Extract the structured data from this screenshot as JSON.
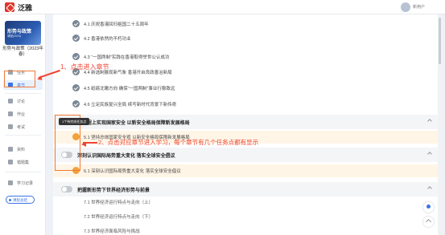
{
  "app": {
    "brand": "泛雅",
    "username": "新用户"
  },
  "sidebar": {
    "cover_title": "形势与政策",
    "cover_sub": "课程(2023)",
    "course_name": "形势与政策（2023年春）",
    "items": [
      {
        "label": "任务",
        "icon": "task-icon"
      },
      {
        "label": "章节",
        "icon": "chapter-icon",
        "active": true
      },
      {
        "label": "讨论",
        "icon": "discussion-icon"
      },
      {
        "label": "作业",
        "icon": "homework-icon"
      },
      {
        "label": "考试",
        "icon": "exam-icon"
      },
      {
        "label": "资料",
        "icon": "materials-icon"
      },
      {
        "label": "错题集",
        "icon": "wrongbook-icon"
      },
      {
        "label": "学习记录",
        "icon": "record-icon"
      }
    ],
    "pill_label": "课程总结"
  },
  "content": {
    "lessons_top": [
      "4.1 庆祝香港回归祖国二十五周年",
      "4.2 香港依然的不朽功业",
      "4.3 “一国两制”实践在香港取得举世公认成功",
      "4.4 新选制展现新气象 香港开启良政善治新局",
      "4.5 砥砺北辙方向 确保“一国两制”事业行稳致远",
      "4.6 立足民族复兴全局 续写新时代背景下新传奇"
    ],
    "chapter5": "新征程上实现国家安全 以新安全格局保障新发展格局",
    "lesson5": "5.1 坚持总体国家安全观 以新安全格局保障新发展格局",
    "chapter6": "深刻认识国际局势重大变化 落实全球安全倡议",
    "lesson6": "6.1 深刻认识国际局势重大变化 落实全球安全倡议",
    "chapter7": "把握新形势下世界经济形势与前景",
    "lessons7": [
      "7.1 世界经济运行特点与走向（上）",
      "7.2 世界经济运行特点与走向（下）",
      "7.3 世界经济面临风险与挑战"
    ],
    "tooltip": "1个待完成任务点"
  },
  "annotations": {
    "step1": "1、点击进入章节",
    "step2": "2、点击对应章节进入学习，每个章节有几个任务点都有显示",
    "color": "#ef4433"
  }
}
